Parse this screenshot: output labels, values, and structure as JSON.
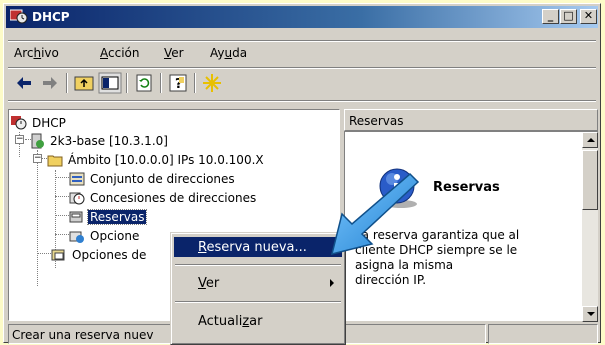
{
  "window": {
    "title": "DHCP"
  },
  "menubar": {
    "items": [
      {
        "pre": "Arc",
        "key": "h",
        "post": "ivo"
      },
      {
        "pre": "",
        "key": "A",
        "post": "cción"
      },
      {
        "pre": "",
        "key": "V",
        "post": "er"
      },
      {
        "pre": "Ay",
        "key": "u",
        "post": "da"
      }
    ]
  },
  "toolbar": {
    "icons": [
      "back-arrow-icon",
      "forward-arrow-icon",
      "up-folder-icon",
      "show-hide-tree-icon",
      "refresh-icon",
      "help-icon",
      "new-star-icon"
    ]
  },
  "tree": {
    "root": "DHCP",
    "server": "2k3-base [10.3.1.0]",
    "scope": "Ámbito [10.0.0.0] IPs 10.0.100.X",
    "pool": "Conjunto de direcciones",
    "leases": "Concesiones de direcciones",
    "reservations": "Reservas",
    "scope_options": "Opcione",
    "server_options": "Opciones de"
  },
  "right": {
    "header": "Reservas",
    "info_title": "Reservas",
    "info_desc_lines": [
      "La reserva garantiza que al",
      "cliente DHCP siempre se le",
      "asigna la misma",
      "dirección IP."
    ]
  },
  "context_menu": {
    "new_reservation": {
      "pre": "",
      "key": "R",
      "post": "eserva nueva..."
    },
    "view": {
      "pre": "",
      "key": "V",
      "post": "er"
    },
    "refresh": {
      "pre": "Actuali",
      "key": "z",
      "post": "ar"
    }
  },
  "status": {
    "text": "Crear una reserva nuev"
  },
  "colors": {
    "selection": "#0a246a",
    "annotation_arrow": "#3aa0e6",
    "desktop_bg": "#fdfbc8"
  }
}
